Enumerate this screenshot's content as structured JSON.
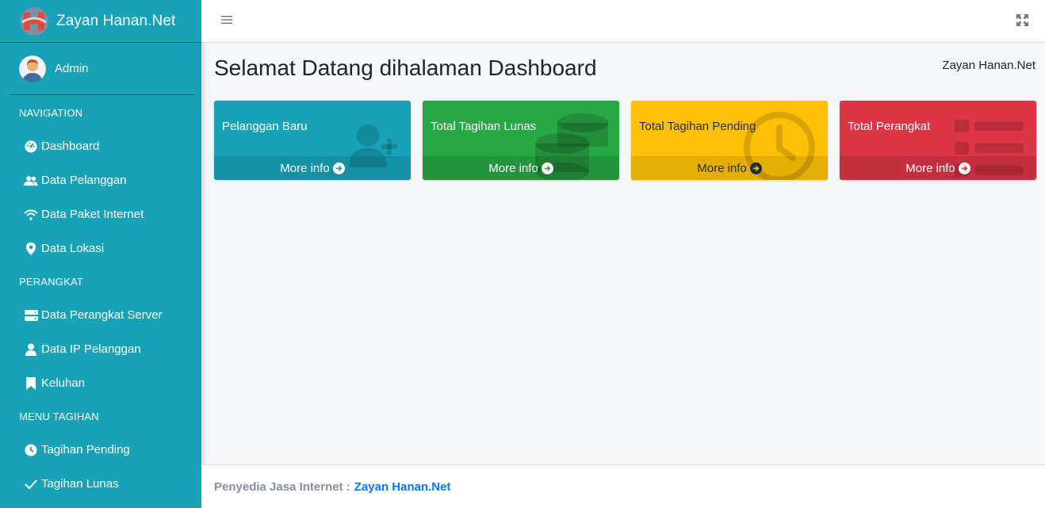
{
  "brand": {
    "name": "Zayan Hanan.Net"
  },
  "user": {
    "name": "Admin"
  },
  "sidebar": {
    "sections": [
      {
        "header": "NAVIGATION",
        "items": [
          {
            "label": "Dashboard",
            "icon": "dashboard-icon"
          },
          {
            "label": "Data Pelanggan",
            "icon": "users-icon"
          },
          {
            "label": "Data Paket Internet",
            "icon": "wifi-icon"
          },
          {
            "label": "Data Lokasi",
            "icon": "map-marker-icon"
          }
        ]
      },
      {
        "header": "PERANGKAT",
        "items": [
          {
            "label": "Data Perangkat Server",
            "icon": "server-icon"
          },
          {
            "label": "Data IP Pelanggan",
            "icon": "user-icon"
          },
          {
            "label": "Keluhan",
            "icon": "bookmark-icon"
          }
        ]
      },
      {
        "header": "MENU TAGIHAN",
        "items": [
          {
            "label": "Tagihan Pending",
            "icon": "clock-icon"
          },
          {
            "label": "Tagihan Lunas",
            "icon": "check-icon"
          }
        ]
      }
    ]
  },
  "header": {
    "title": "Selamat Datang dihalaman Dashboard",
    "crumb": "Zayan Hanan.Net"
  },
  "boxes": [
    {
      "title": "Pelanggan Baru",
      "more": "More info",
      "color": "#17a2b8",
      "icon": "user-plus-icon"
    },
    {
      "title": "Total Tagihan Lunas",
      "more": "More info",
      "color": "#28a745",
      "icon": "coins-icon"
    },
    {
      "title": "Total Tagihan Pending",
      "more": "More info",
      "color": "#ffc107",
      "icon": "clock-icon"
    },
    {
      "title": "Total Perangkat",
      "more": "More info",
      "color": "#dc3545",
      "icon": "list-icon"
    }
  ],
  "footer": {
    "label": "Penyedia Jasa Internet :",
    "link": "Zayan Hanan.Net"
  }
}
